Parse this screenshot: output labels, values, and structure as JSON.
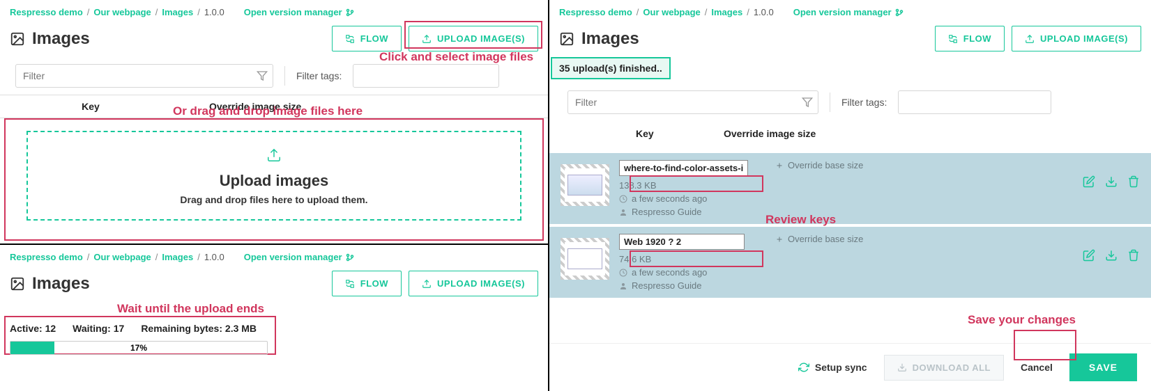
{
  "colors": {
    "accent": "#16c79a",
    "annot": "#d1365d"
  },
  "breadcrumb": {
    "items": [
      "Respresso demo",
      "Our webpage",
      "Images"
    ],
    "version": "1.0.0"
  },
  "ovm_label": "Open version manager",
  "page_title": "Images",
  "buttons": {
    "flow": "FLOW",
    "upload": "UPLOAD IMAGE(S)"
  },
  "filter": {
    "placeholder": "Filter",
    "tags_label": "Filter tags:"
  },
  "table": {
    "key_header": "Key",
    "override_header": "Override image size"
  },
  "dropzone": {
    "title": "Upload images",
    "sub": "Drag and drop files here to upload them."
  },
  "annotations": {
    "click_select": "Click and select image files",
    "drag_drop": "Or drag and drop image files here",
    "wait": "Wait until the upload ends",
    "review": "Review keys",
    "save": "Save your changes"
  },
  "progress": {
    "active_label": "Active:",
    "active": "12",
    "waiting_label": "Waiting:",
    "waiting": "17",
    "remaining_label": "Remaining bytes:",
    "remaining": "2.3 MB",
    "percent_text": "17%",
    "percent": 17
  },
  "toast": "35 upload(s) finished..",
  "override_add": "Override base size",
  "rows": [
    {
      "key": "where-to-find-color-assets-i",
      "size": "138.3 KB",
      "time": "a few seconds ago",
      "user": "Respresso Guide"
    },
    {
      "key": "Web 1920 ? 2",
      "size": "74.6 KB",
      "time": "a few seconds ago",
      "user": "Respresso Guide"
    }
  ],
  "footer": {
    "setup": "Setup sync",
    "download": "DOWNLOAD ALL",
    "cancel": "Cancel",
    "save": "SAVE"
  }
}
